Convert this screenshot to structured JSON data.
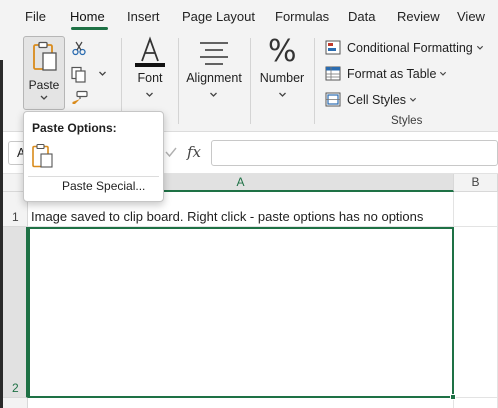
{
  "tabs": [
    {
      "label": "File"
    },
    {
      "label": "Home"
    },
    {
      "label": "Insert"
    },
    {
      "label": "Page Layout"
    },
    {
      "label": "Formulas"
    },
    {
      "label": "Data"
    },
    {
      "label": "Review"
    },
    {
      "label": "View"
    }
  ],
  "active_tab": "Home",
  "ribbon": {
    "clipboard": {
      "paste_label": "Paste"
    },
    "font": {
      "label": "Font"
    },
    "alignment": {
      "label": "Alignment"
    },
    "number": {
      "label": "Number",
      "icon_text": "%"
    },
    "styles": {
      "group_label": "Styles",
      "conditional_formatting": "Conditional Formatting",
      "format_as_table": "Format as Table",
      "cell_styles": "Cell Styles"
    }
  },
  "paste_popup": {
    "title": "Paste Options:",
    "paste_special": "Paste Special..."
  },
  "formula_bar": {
    "name_box": "A",
    "fx": "fx",
    "formula": ""
  },
  "sheet": {
    "columns": [
      "A",
      "B"
    ],
    "rows": [
      "1",
      "2"
    ],
    "selected_column": "A",
    "selected_row": "2",
    "cells": {
      "A1": "Image saved to clip board.  Right click - paste options has no options",
      "A2": ""
    }
  },
  "colors": {
    "accent": "#1e7145",
    "ribbon_bg": "#f3f3f3",
    "paste_icon": "#d98b1c"
  }
}
